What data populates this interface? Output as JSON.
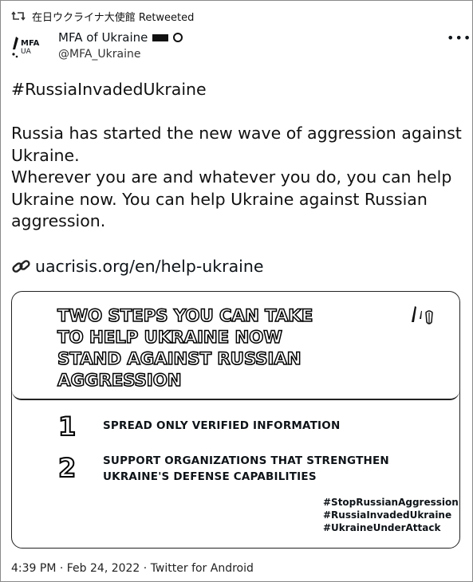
{
  "retweet": {
    "label": "在日ウクライナ大使館 Retweeted"
  },
  "author": {
    "avatar_text": "MFA",
    "avatar_subtext": "UA",
    "name": "MFA of Ukraine",
    "handle": "@MFA_Ukraine"
  },
  "tweet": {
    "hashtag": "#RussiaInvadedUkraine",
    "lines": [
      "Russia has started the new wave of aggression against",
      "Ukraine.",
      "Wherever you are and whatever you do, you can help",
      "Ukraine now. You can help Ukraine against Russian",
      "aggression."
    ],
    "link": "uacrisis.org/en/help-ukraine"
  },
  "card": {
    "headline_lines": [
      "TWO STEPS YOU CAN TAKE",
      "TO HELP UKRAINE NOW",
      "STAND AGAINST RUSSIAN",
      "AGGRESSION"
    ],
    "steps": [
      {
        "number": "1",
        "lines": [
          "SPREAD ONLY VERIFIED INFORMATION"
        ]
      },
      {
        "number": "2",
        "lines": [
          "SUPPORT ORGANIZATIONS THAT STRENGTHEN",
          "UKRAINE'S DEFENSE CAPABILITIES"
        ]
      }
    ],
    "hashtags": [
      "#StopRussianAggression",
      "#RussiaInvadedUkraine",
      "#UkraineUnderAttack"
    ]
  },
  "meta": {
    "timestamp": "4:39 PM · Feb 24, 2022 · Twitter for Android"
  },
  "icons": {
    "retweet": "retweet-icon",
    "more": "more-icon",
    "link": "link-icon",
    "verified": "verified-badge-icon",
    "flag": "flag-icon"
  }
}
